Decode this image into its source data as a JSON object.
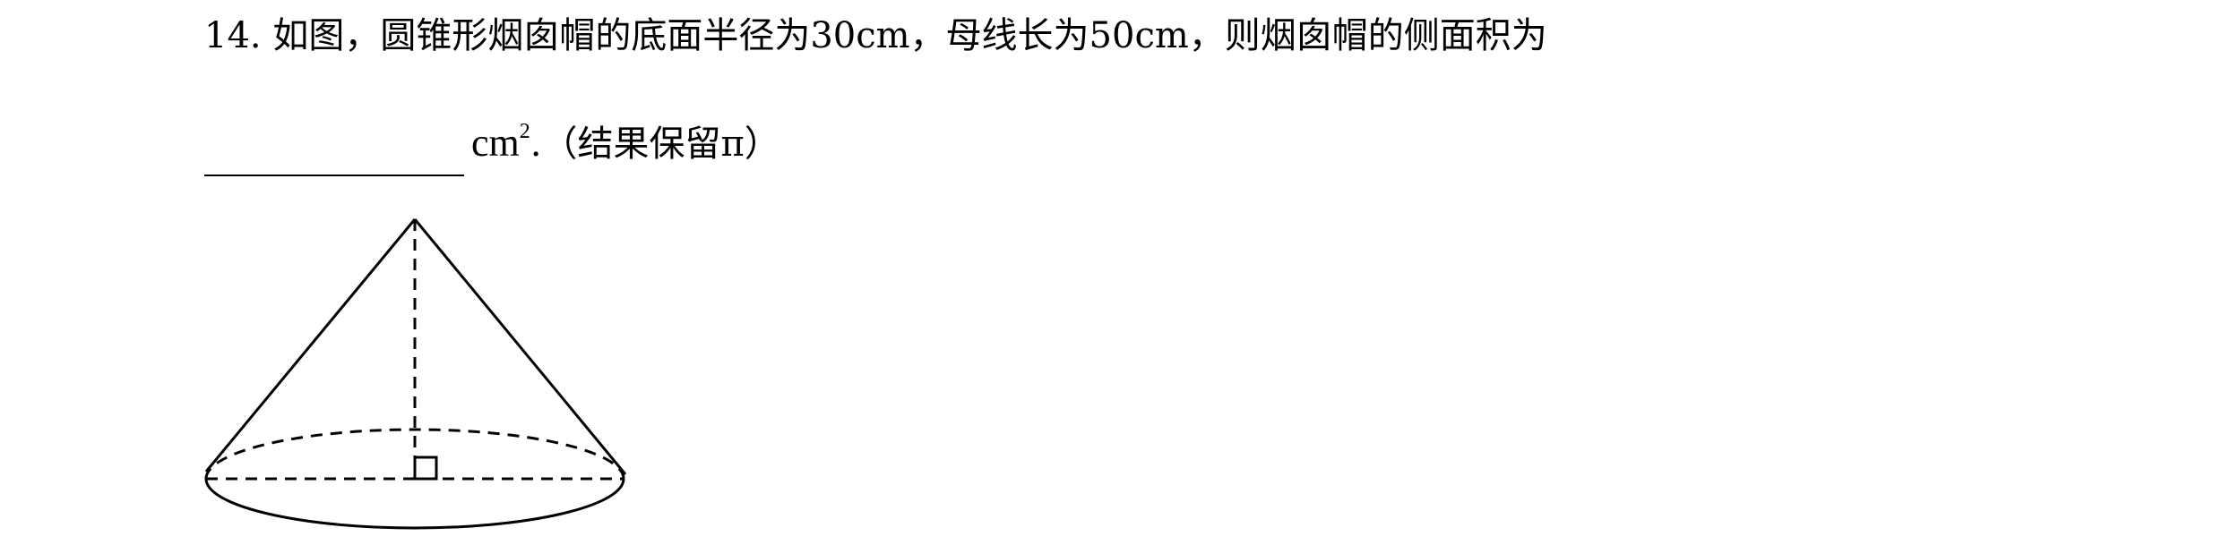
{
  "question": {
    "text": "14. 如图，圆锥形烟囱帽的底面半径为30cm，母线长为50cm，则烟囱帽的侧面积为",
    "unit": "cm",
    "unit_exponent": "2",
    "suffix": ".（结果保留π）"
  },
  "figure": {
    "shape": "cone",
    "lines": {
      "height": "dashed",
      "base_radius": "dashed",
      "back_arc": "dashed",
      "front_arc": "solid"
    },
    "right_angle_marker": true
  }
}
